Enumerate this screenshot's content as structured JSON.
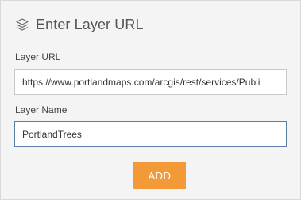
{
  "header": {
    "title": "Enter Layer URL",
    "icon": "layers-icon"
  },
  "form": {
    "url_label": "Layer URL",
    "url_value": "https://www.portlandmaps.com/arcgis/rest/services/Publi",
    "name_label": "Layer Name",
    "name_value": "PortlandTrees"
  },
  "actions": {
    "add_label": "ADD"
  },
  "colors": {
    "panel_bg": "#f4f4f4",
    "accent": "#f29a38",
    "focus_border": "#5a7fa8"
  }
}
